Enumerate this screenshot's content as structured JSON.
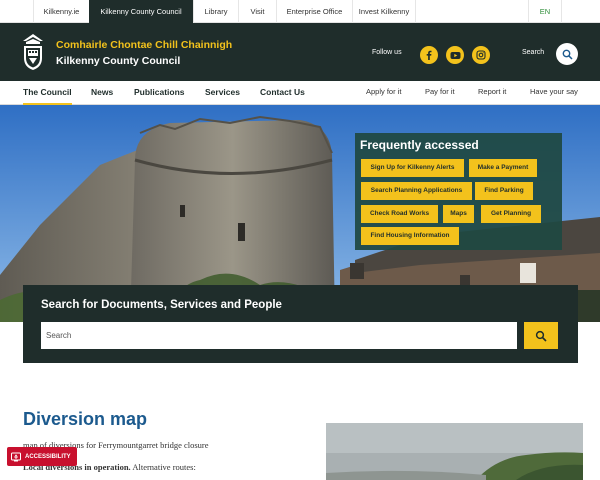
{
  "top_tabs": [
    {
      "label": "Kilkenny.ie",
      "active": false
    },
    {
      "label": "Kilkenny County Council",
      "active": true
    },
    {
      "label": "Library",
      "active": false
    },
    {
      "label": "Visit",
      "active": false
    },
    {
      "label": "Enterprise Office",
      "active": false
    },
    {
      "label": "Invest Kilkenny",
      "active": false
    }
  ],
  "language": "EN",
  "header": {
    "name_irish": "Comhairle Chontae Chill Chainnigh",
    "name_english": "Kilkenny County Council",
    "follow_label": "Follow us",
    "social_icons": [
      "facebook-icon",
      "youtube-icon",
      "instagram-icon"
    ],
    "search_label": "Search"
  },
  "nav": {
    "main": [
      "The Council",
      "News",
      "Publications",
      "Services",
      "Contact Us"
    ],
    "secondary": [
      "Apply for it",
      "Pay for it",
      "Report it",
      "Have your say"
    ]
  },
  "frequently_accessed": {
    "title": "Frequently accessed",
    "buttons": [
      "Sign Up for Kilkenny Alerts",
      "Make a Payment",
      "Search Planning Applications",
      "Find Parking",
      "Check Road Works",
      "Maps",
      "Get Planning",
      "Find Housing Information"
    ]
  },
  "search": {
    "title": "Search for Documents, Services and People",
    "placeholder": "Search"
  },
  "content": {
    "title": "Diversion map",
    "description": "map of diversions for Ferrymountgarret bridge closure",
    "local_bold": "Local diversions in operation.",
    "local_rest": " Alternative routes:"
  },
  "accessibility_label": "ACCESSIBILITY",
  "colors": {
    "dark_green": "#1f2d2b",
    "accent_yellow": "#f3c21c",
    "title_blue": "#1c5a8e",
    "accessibility_red": "#c8102e",
    "lang_green": "#2f8f3a"
  }
}
